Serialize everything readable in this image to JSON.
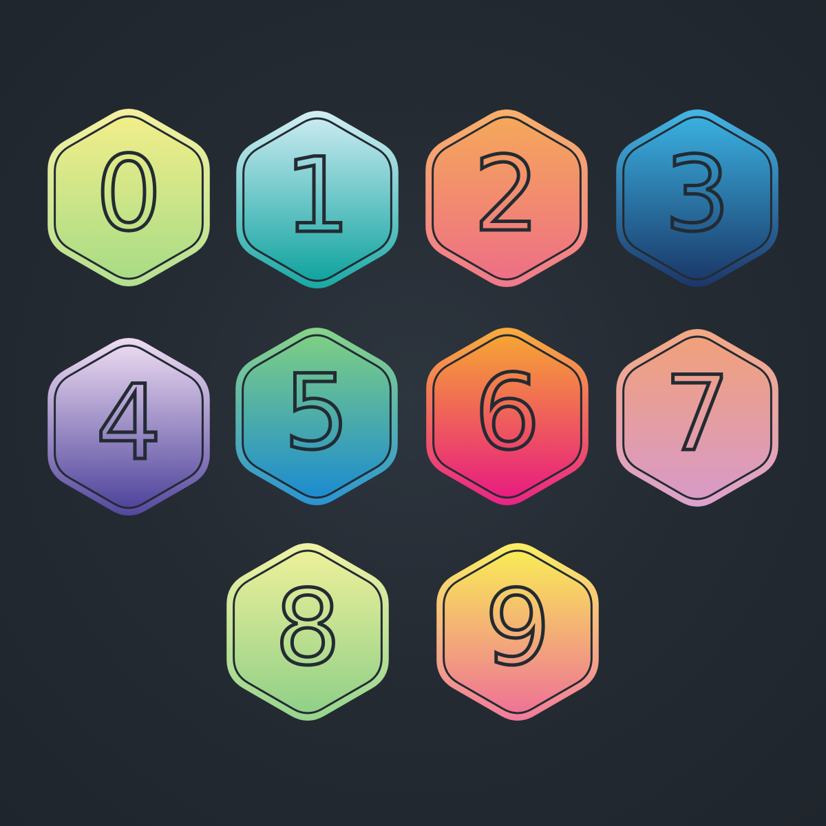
{
  "badges": [
    {
      "digit": "0",
      "colors": [
        "#f2ee8a",
        "#a8dc86"
      ],
      "rim": [
        "#f4f0a0",
        "#b4e090"
      ]
    },
    {
      "digit": "1",
      "colors": [
        "#c8eaf0",
        "#10a39f"
      ],
      "rim": [
        "#d2eef4",
        "#1aa8a4"
      ]
    },
    {
      "digit": "2",
      "colors": [
        "#f5a85a",
        "#ee6f85"
      ],
      "rim": [
        "#f7b06a",
        "#f07a8a"
      ]
    },
    {
      "digit": "3",
      "colors": [
        "#3ab0e0",
        "#1a3a6a"
      ],
      "rim": [
        "#44b6e4",
        "#1c3668"
      ]
    },
    {
      "digit": "4",
      "colors": [
        "#ead8ef",
        "#4f449c"
      ],
      "rim": [
        "#eedcf2",
        "#54489e"
      ]
    },
    {
      "digit": "5",
      "colors": [
        "#7ecf84",
        "#1c8bcf"
      ],
      "rim": [
        "#88d38a",
        "#2a94d2"
      ]
    },
    {
      "digit": "6",
      "colors": [
        "#f6a534",
        "#e81c80"
      ],
      "rim": [
        "#f8ac3e",
        "#ea2484"
      ]
    },
    {
      "digit": "7",
      "colors": [
        "#f1a17a",
        "#d89ac8"
      ],
      "rim": [
        "#f3a984",
        "#dca2cc"
      ]
    },
    {
      "digit": "8",
      "colors": [
        "#eef09a",
        "#90d088"
      ],
      "rim": [
        "#f0f2a4",
        "#96d48e"
      ]
    },
    {
      "digit": "9",
      "colors": [
        "#f9ec56",
        "#ee7396"
      ],
      "rim": [
        "#faee64",
        "#f07c9c"
      ]
    }
  ],
  "digit_color": "#232b33",
  "hex_outline_color": "#232b33"
}
